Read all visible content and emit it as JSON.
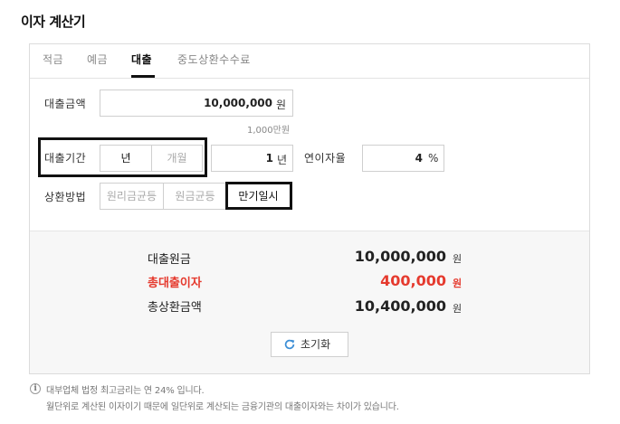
{
  "title": "이자 계산기",
  "tabs": [
    {
      "label": "적금"
    },
    {
      "label": "예금"
    },
    {
      "label": "대출"
    },
    {
      "label": "중도상환수수료"
    }
  ],
  "loan": {
    "amount_label": "대출금액",
    "amount_value": "10,000,000",
    "amount_unit": "원",
    "amount_note": "1,000만원",
    "period_label": "대출기간",
    "period_year": "년",
    "period_month": "개월",
    "period_value": "1",
    "period_unit": "년",
    "rate_label": "연이자율",
    "rate_value": "4",
    "rate_unit": "%",
    "method_label": "상환방법",
    "methods": [
      {
        "label": "원리금균등"
      },
      {
        "label": "원금균등"
      },
      {
        "label": "만기일시"
      }
    ]
  },
  "result": {
    "principal_label": "대출원금",
    "principal_value": "10,000,000",
    "interest_label": "총대출이자",
    "interest_value": "400,000",
    "total_label": "총상환금액",
    "total_value": "10,400,000",
    "unit": "원",
    "reset_label": "초기화"
  },
  "footnote": {
    "icon": "i",
    "line1": "대부업체 법정 최고금리는 연 24% 입니다.",
    "line2": "월단위로 계산된 이자이기 때문에 일단위로 계산되는 금융기관의 대출이자와는 차이가 있습니다."
  },
  "colors": {
    "accent": "#111111",
    "interest": "#e53a2e",
    "refresh_icon": "#3d8fd6"
  }
}
